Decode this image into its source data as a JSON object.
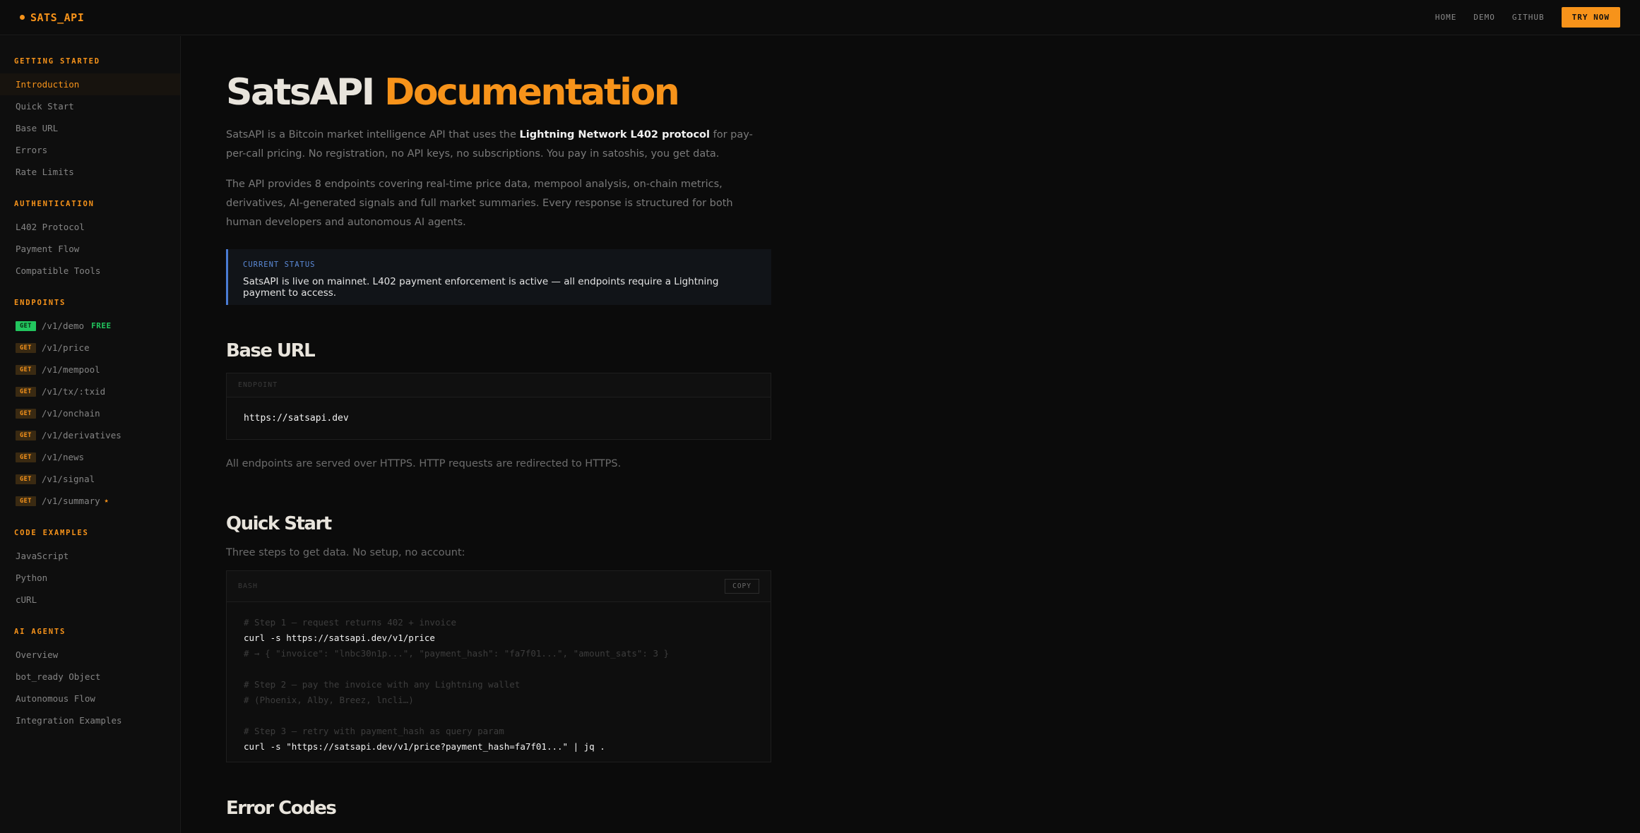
{
  "brand": {
    "name": "SATS_API",
    "accent": "#f7931a"
  },
  "nav": {
    "home": "HOME",
    "demo": "DEMO",
    "github": "GITHUB",
    "cta": "TRY NOW"
  },
  "sidebar": {
    "getting_started": {
      "heading": "GETTING STARTED",
      "items": [
        "Introduction",
        "Quick Start",
        "Base URL",
        "Errors",
        "Rate Limits"
      ]
    },
    "authentication": {
      "heading": "AUTHENTICATION",
      "items": [
        "L402 Protocol",
        "Payment Flow",
        "Compatible Tools"
      ]
    },
    "endpoints": {
      "heading": "ENDPOINTS",
      "method": "GET",
      "free_tag": "FREE",
      "star": "★",
      "items": [
        "/v1/demo",
        "/v1/price",
        "/v1/mempool",
        "/v1/tx/:txid",
        "/v1/onchain",
        "/v1/derivatives",
        "/v1/news",
        "/v1/signal",
        "/v1/summary"
      ]
    },
    "code_examples": {
      "heading": "CODE EXAMPLES",
      "items": [
        "JavaScript",
        "Python",
        "cURL"
      ]
    },
    "ai_agents": {
      "heading": "AI AGENTS",
      "items": [
        "Overview",
        "bot_ready Object",
        "Autonomous Flow",
        "Integration Examples"
      ]
    }
  },
  "main": {
    "title_part1": "SatsAPI",
    "title_part2": "Documentation",
    "intro1_pre": "SatsAPI is a Bitcoin market intelligence API that uses the ",
    "intro1_strong": "Lightning Network L402 protocol",
    "intro1_post": " for pay-per-call pricing. No registration, no API keys, no subscriptions. You pay in satoshis, you get data.",
    "intro2": "The API provides 8 endpoints covering real-time price data, mempool analysis, on-chain metrics, derivatives, AI-generated signals and full market summaries. Every response is structured for both human developers and autonomous AI agents.",
    "status": {
      "label": "CURRENT STATUS",
      "text": "SatsAPI is live on mainnet. L402 payment enforcement is active — all endpoints require a Lightning payment to access."
    },
    "base_url": {
      "heading": "Base URL",
      "block_label": "ENDPOINT",
      "url": "https://satsapi.dev",
      "note": "All endpoints are served over HTTPS. HTTP requests are redirected to HTTPS."
    },
    "quick_start": {
      "heading": "Quick Start",
      "intro": "Three steps to get data. No setup, no account:",
      "block_label": "BASH",
      "copy": "COPY",
      "lines": [
        "# Step 1 — request returns 402 + invoice",
        "curl -s https://satsapi.dev/v1/price",
        "# → { \"invoice\": \"lnbc30n1p...\", \"payment_hash\": \"fa7f01...\", \"amount_sats\": 3 }",
        "",
        "# Step 2 — pay the invoice with any Lightning wallet",
        "# (Phoenix, Alby, Breez, lncli…)",
        "",
        "# Step 3 — retry with payment_hash as query param",
        "curl -s \"https://satsapi.dev/v1/price?payment_hash=fa7f01...\" | jq ."
      ]
    },
    "errors": {
      "heading": "Error Codes"
    }
  }
}
